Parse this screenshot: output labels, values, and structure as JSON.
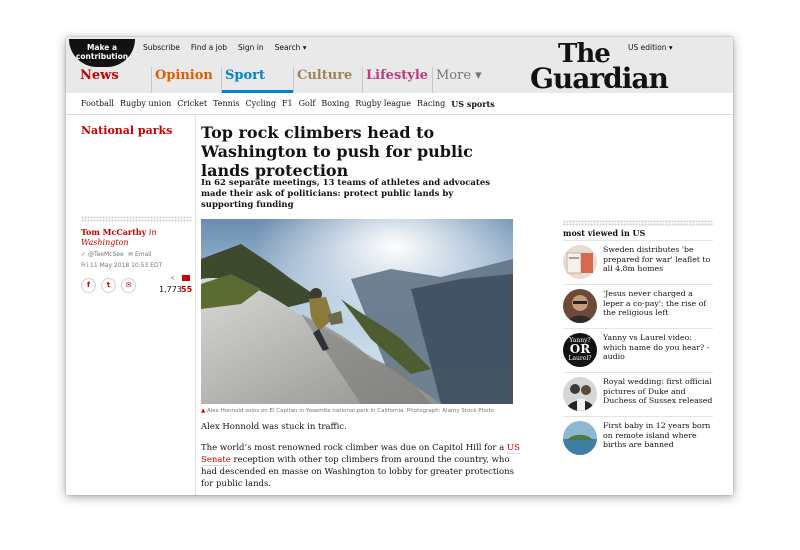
{
  "header": {
    "contribute_line1": "Make a",
    "contribute_line2": "contribution",
    "top_links": [
      "Subscribe",
      "Find a job",
      "Sign in",
      "Search ▾"
    ],
    "edition": "US edition ▾",
    "logo_line1": "The",
    "logo_line2": "Guardian"
  },
  "pillars": [
    {
      "label": "News",
      "color": "#c70000"
    },
    {
      "label": "Opinion",
      "color": "#e05e00"
    },
    {
      "label": "Sport",
      "color": "#0084c6"
    },
    {
      "label": "Culture",
      "color": "#a1845c"
    },
    {
      "label": "Lifestyle",
      "color": "#bb3b80"
    },
    {
      "label": "More ▾",
      "color": "#767676"
    }
  ],
  "subnav": [
    "Football",
    "Rugby union",
    "Cricket",
    "Tennis",
    "Cycling",
    "F1",
    "Golf",
    "Boxing",
    "Rugby league",
    "Racing",
    "US sports"
  ],
  "article": {
    "section": "National parks",
    "headline": "Top rock climbers head to Washington to push for public lands protection",
    "standfirst": "In 62 separate meetings, 13 teams of athletes and advocates made their ask of politicians: protect public lands by supporting funding",
    "author_name": "Tom McCarthy",
    "author_in": "in",
    "author_place": "Washington",
    "twitter": "@TeeMcSee",
    "email_label": "Email",
    "date": "Fri 11 May 2018 10.53 EDT",
    "share_count": "1,773",
    "comment_count": "55",
    "caption_marker": "▲",
    "caption": "Alex Honnold solos on El Capitan in Yosemite national park in California. Photograph: Alamy Stock Photo",
    "para1": "Alex Honnold was stuck in traffic.",
    "para2_a": "The world’s most renowned rock climber was due on Capitol Hill for a",
    "para2_link": "US Senate",
    "para2_b": "reception with other top climbers from around the country, who had descended en masse on Washington to lobby for greater protections for public lands."
  },
  "most_viewed": {
    "title": "most viewed in US",
    "items": [
      {
        "text": "Sweden distributes 'be prepared for war' leaflet to all 4.8m homes"
      },
      {
        "text": "'Jesus never charged a leper a co-pay': the rise of the religious left"
      },
      {
        "text": "Yanny vs Laurel video: which name do you hear? - audio",
        "thumb_text_1": "Yanny?",
        "thumb_text_2": "OR",
        "thumb_text_3": "Laurel?"
      },
      {
        "text": "Royal wedding: first official pictures of Duke and Duchess of Sussex released"
      },
      {
        "text": "First baby in 12 years born on remote island where births are banned"
      }
    ]
  },
  "share_icons": [
    "f",
    "t",
    "✉"
  ]
}
